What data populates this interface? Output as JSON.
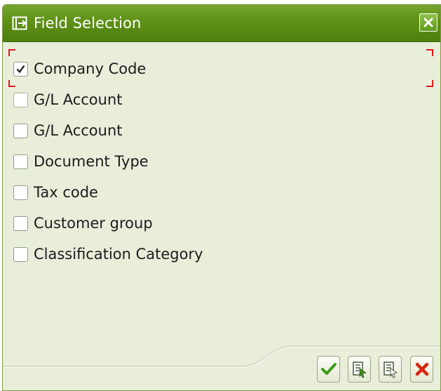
{
  "dialog": {
    "title": "Field Selection",
    "title_icon": "dialog-window-icon",
    "close_icon": "close-icon"
  },
  "fields": [
    {
      "label": "Company Code",
      "checked": true
    },
    {
      "label": "G/L Account",
      "checked": false
    },
    {
      "label": "G/L Account",
      "checked": false
    },
    {
      "label": "Document Type",
      "checked": false
    },
    {
      "label": "Tax code",
      "checked": false
    },
    {
      "label": "Customer group",
      "checked": false
    },
    {
      "label": "Classification Category",
      "checked": false
    }
  ],
  "footer": {
    "buttons": [
      {
        "name": "confirm-button",
        "icon": "checkmark-icon"
      },
      {
        "name": "select-all-button",
        "icon": "select-all-icon"
      },
      {
        "name": "deselect-all-button",
        "icon": "deselect-all-icon"
      },
      {
        "name": "cancel-button",
        "icon": "cancel-x-icon"
      }
    ]
  },
  "colors": {
    "titlebar": "#5e9116",
    "background": "#e9eedb",
    "focus": "#e0191f",
    "confirm": "#3e9a1b",
    "cancel": "#d8260f"
  }
}
